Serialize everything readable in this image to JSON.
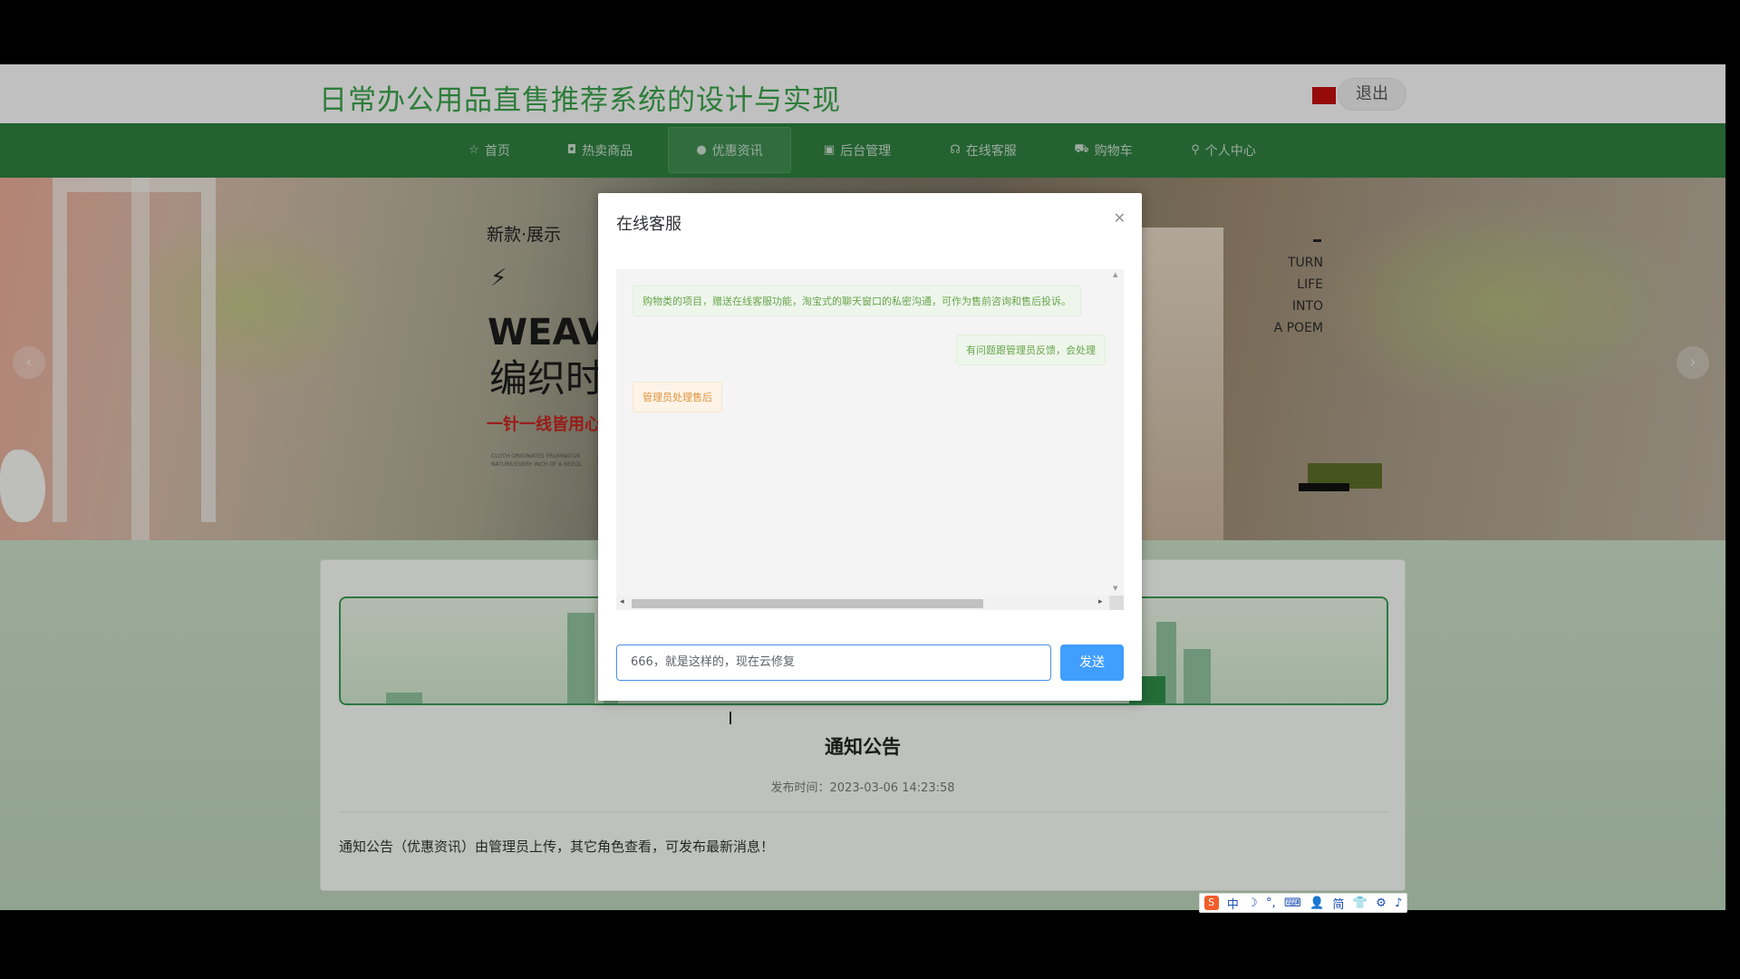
{
  "header": {
    "site_title": "日常办公用品直售推荐系统的设计与实现",
    "logout_label": "退出"
  },
  "nav": [
    {
      "icon": "star-icon",
      "glyph": "☆",
      "label": "首页"
    },
    {
      "icon": "bag-icon",
      "glyph": "◘",
      "label": "热卖商品"
    },
    {
      "icon": "info-icon",
      "glyph": "●",
      "label": "优惠资讯"
    },
    {
      "icon": "admin-icon",
      "glyph": "▣",
      "label": "后台管理"
    },
    {
      "icon": "headset-icon",
      "glyph": "☊",
      "label": "在线客服"
    },
    {
      "icon": "cart-icon",
      "glyph": "⛟",
      "label": "购物车"
    },
    {
      "icon": "user-icon",
      "glyph": "⚲",
      "label": "个人中心"
    }
  ],
  "banner": {
    "subtitle": "新款·展示",
    "weave": "WEAV",
    "cn_title": "编织时",
    "red_line": "一针一线皆用心",
    "small_text_1": "CLOTH ORIGINATES FROMNATUR",
    "small_text_2": "NATURE/EVERY INCH OF A NEEDL",
    "tags": [
      "TURN",
      "LIFE",
      "INTO",
      "A POEM"
    ]
  },
  "dialog": {
    "title": "在线客服",
    "messages": [
      {
        "side": "left",
        "color": "green",
        "text": "购物类的项目，赠送在线客服功能，淘宝式的聊天窗口的私密沟通，可作为售前咨询和售后投诉。"
      },
      {
        "side": "right",
        "color": "green",
        "text": "有问题跟管理员反馈，会处理"
      },
      {
        "side": "left",
        "color": "orange",
        "text": "管理员处理售后"
      }
    ],
    "input_value": "666，就是这样的，现在云修复",
    "send_label": "发送"
  },
  "notice": {
    "title": "通知公告",
    "time_label": "发布时间：",
    "time_value": "2023-03-06 14:23:58",
    "body": "通知公告（优惠资讯）由管理员上传，其它角色查看，可发布最新消息！"
  },
  "ime": {
    "items": [
      "中",
      "☽",
      "°,",
      "⌨",
      "👤",
      "简",
      "👕",
      "⚙",
      "♪"
    ]
  }
}
